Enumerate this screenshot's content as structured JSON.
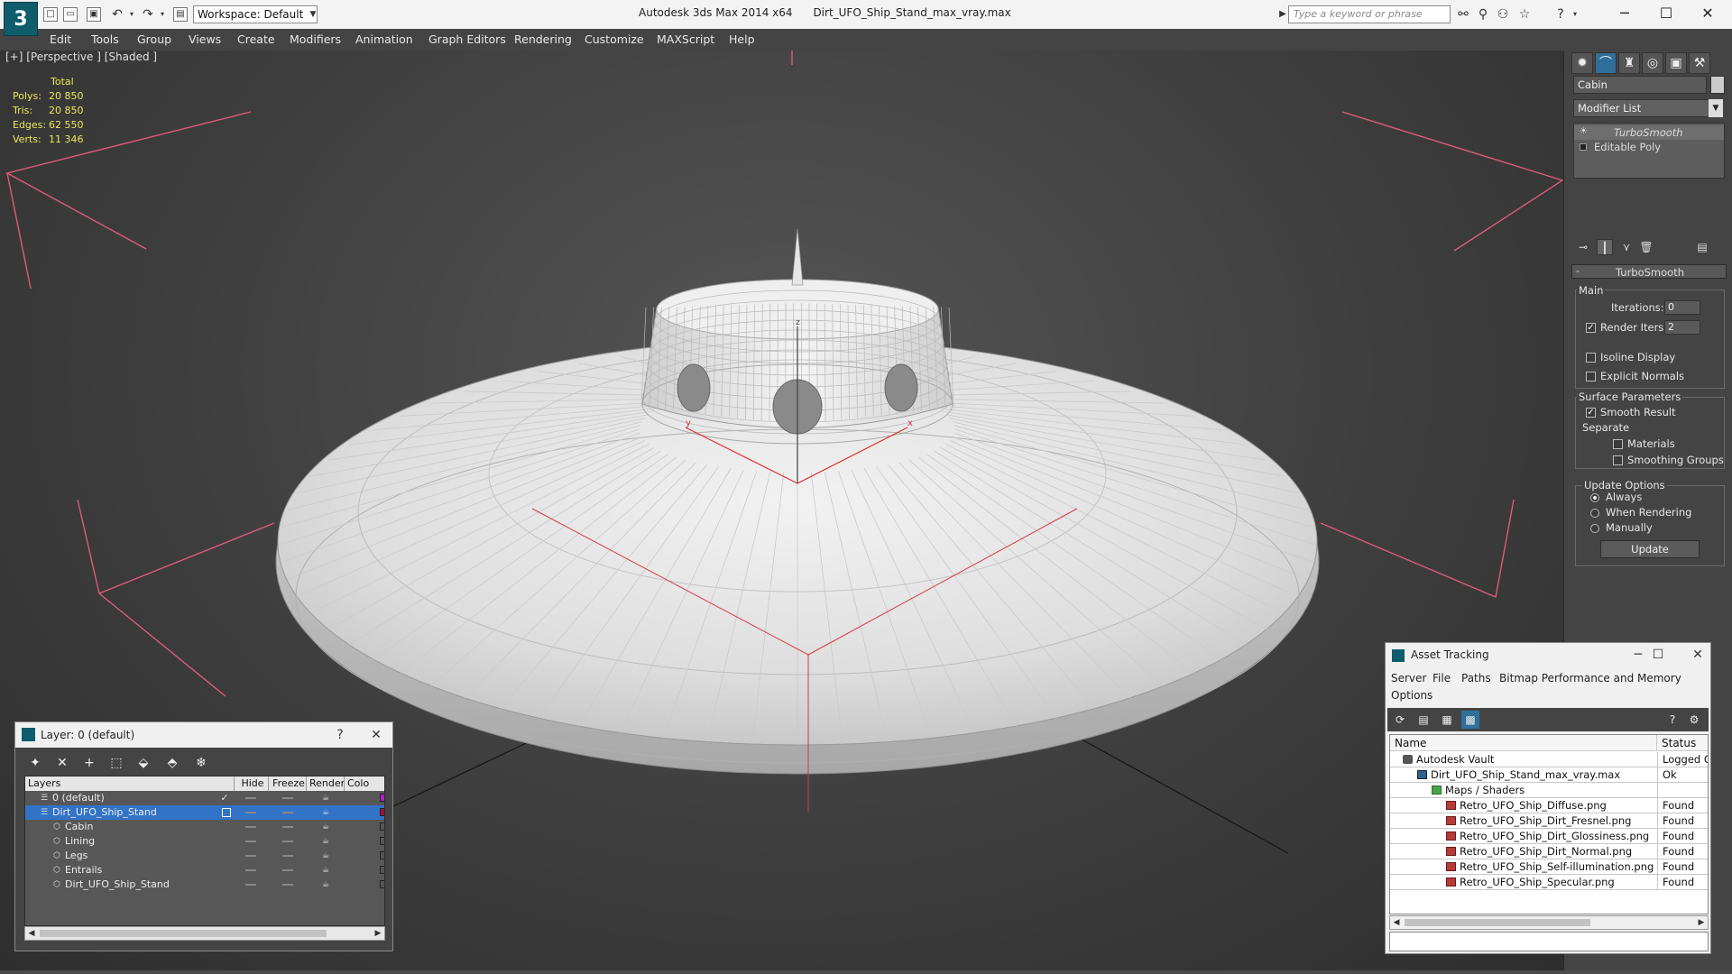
{
  "titlebar": {
    "app_logo": "3",
    "workspace": "Workspace: Default",
    "title_app": "Autodesk 3ds Max 2014 x64",
    "title_file": "Dirt_UFO_Ship_Stand_max_vray.max",
    "search_placeholder": "Type a keyword or phrase"
  },
  "menu": [
    "Edit",
    "Tools",
    "Group",
    "Views",
    "Create",
    "Modifiers",
    "Animation",
    "Graph Editors",
    "Rendering",
    "Customize",
    "MAXScript",
    "Help"
  ],
  "viewport": {
    "label": "[+] [Perspective ] [Shaded ]",
    "stats_header": "Total",
    "stats": [
      {
        "label": "Polys:",
        "value": "20 850"
      },
      {
        "label": "Tris:",
        "value": "20 850"
      },
      {
        "label": "Edges:",
        "value": "62 550"
      },
      {
        "label": "Verts:",
        "value": "11 346"
      }
    ],
    "gizmo": {
      "x_label": "x",
      "y_label": "y",
      "z_label": "z"
    }
  },
  "command_panel": {
    "object_name": "Cabin",
    "modifier_list": "Modifier List",
    "stack": [
      {
        "label": "TurboSmooth",
        "active": true
      },
      {
        "label": "Editable Poly",
        "active": false
      }
    ],
    "rollout_title": "TurboSmooth",
    "main_label": "Main",
    "iterations_label": "Iterations:",
    "iterations_value": "0",
    "render_iters_label": "Render Iters:",
    "render_iters_value": "2",
    "render_iters_checked": true,
    "isoline_label": "Isoline Display",
    "explicit_normals_label": "Explicit Normals",
    "surface_label": "Surface Parameters",
    "smooth_result_label": "Smooth Result",
    "separate_label": "Separate",
    "materials_label": "Materials",
    "smoothing_groups_label": "Smoothing Groups",
    "update_options_label": "Update Options",
    "always_label": "Always",
    "when_rendering_label": "When Rendering",
    "manually_label": "Manually",
    "update_button": "Update"
  },
  "layer_panel": {
    "title": "Layer: 0 (default)",
    "help": "?",
    "columns": [
      "Layers",
      "Hide",
      "Freeze",
      "Render",
      "Colo"
    ],
    "rows": [
      {
        "name": "0 (default)",
        "indent": 0,
        "selected": false,
        "color": "#b020c8",
        "checked": true
      },
      {
        "name": "Dirt_UFO_Ship_Stand",
        "indent": 0,
        "selected": true,
        "color": "#a0103a",
        "checked": false
      },
      {
        "name": "Cabin",
        "indent": 1,
        "selected": false,
        "color": "#555555",
        "checked": false
      },
      {
        "name": "Lining",
        "indent": 1,
        "selected": false,
        "color": "#555555",
        "checked": false
      },
      {
        "name": "Legs",
        "indent": 1,
        "selected": false,
        "color": "#555555",
        "checked": false
      },
      {
        "name": "Entrails",
        "indent": 1,
        "selected": false,
        "color": "#555555",
        "checked": false
      },
      {
        "name": "Dirt_UFO_Ship_Stand",
        "indent": 1,
        "selected": false,
        "color": "#555555",
        "checked": false
      }
    ]
  },
  "asset_panel": {
    "title": "Asset Tracking",
    "menu": [
      "Server",
      "File",
      "Paths",
      "Bitmap Performance and Memory",
      "Options"
    ],
    "columns": [
      "Name",
      "Status"
    ],
    "rows": [
      {
        "name": "Autodesk Vault",
        "status": "Logged Ou",
        "indent": 0,
        "icon": "vault"
      },
      {
        "name": "Dirt_UFO_Ship_Stand_max_vray.max",
        "status": "Ok",
        "indent": 1,
        "icon": "max"
      },
      {
        "name": "Maps / Shaders",
        "status": "",
        "indent": 2,
        "icon": "folder"
      },
      {
        "name": "Retro_UFO_Ship_Diffuse.png",
        "status": "Found",
        "indent": 3,
        "icon": "png"
      },
      {
        "name": "Retro_UFO_Ship_Dirt_Fresnel.png",
        "status": "Found",
        "indent": 3,
        "icon": "png"
      },
      {
        "name": "Retro_UFO_Ship_Dirt_Glossiness.png",
        "status": "Found",
        "indent": 3,
        "icon": "png"
      },
      {
        "name": "Retro_UFO_Ship_Dirt_Normal.png",
        "status": "Found",
        "indent": 3,
        "icon": "png"
      },
      {
        "name": "Retro_UFO_Ship_Self-illumination.png",
        "status": "Found",
        "indent": 3,
        "icon": "png"
      },
      {
        "name": "Retro_UFO_Ship_Specular.png",
        "status": "Found",
        "indent": 3,
        "icon": "png"
      }
    ]
  }
}
